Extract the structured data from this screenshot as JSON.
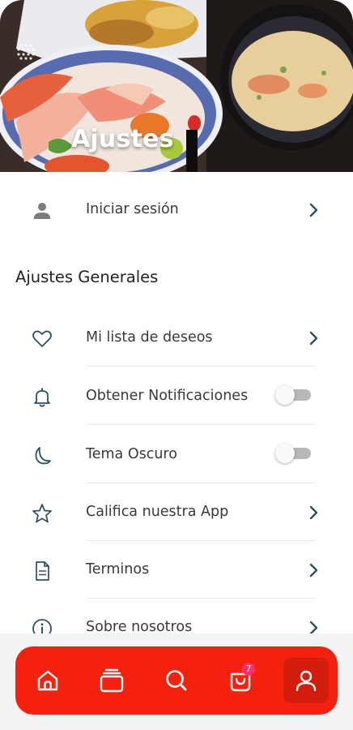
{
  "header": {
    "title": "Ajustes",
    "image": "food-banner"
  },
  "account": {
    "login_label": "Iniciar sesión",
    "icon": "person-icon"
  },
  "general": {
    "section_title": "Ajustes Generales",
    "items": [
      {
        "label": "Mi lista de deseos",
        "icon": "heart-icon",
        "control": "chevron"
      },
      {
        "label": "Obtener Notificaciones",
        "icon": "bell-icon",
        "control": "toggle",
        "enabled": false
      },
      {
        "label": "Tema Oscuro",
        "icon": "moon-icon",
        "control": "toggle",
        "enabled": false
      },
      {
        "label": "Califica nuestra App",
        "icon": "star-icon",
        "control": "chevron"
      },
      {
        "label": "Terminos",
        "icon": "document-icon",
        "control": "chevron"
      },
      {
        "label": "Sobre nosotros",
        "icon": "info-icon",
        "control": "chevron"
      }
    ]
  },
  "bottom_nav": {
    "items": [
      {
        "icon": "home-icon"
      },
      {
        "icon": "collection-icon"
      },
      {
        "icon": "search-icon"
      },
      {
        "icon": "cart-icon",
        "badge": "7"
      },
      {
        "icon": "profile-icon",
        "active": true
      }
    ]
  },
  "colors": {
    "accent": "#f4210f",
    "icon": "#2f5063",
    "badge": "#ff2f6d",
    "toggle_off": "#b8b8b8"
  }
}
